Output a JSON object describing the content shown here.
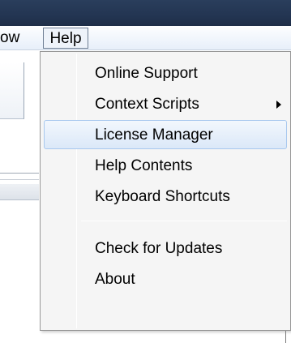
{
  "menubar": {
    "items": [
      {
        "label": "Window",
        "visible_label": "ow"
      },
      {
        "label": "Help"
      }
    ]
  },
  "help_menu": {
    "items": [
      {
        "label": "Online Support"
      },
      {
        "label": "Context Scripts",
        "has_submenu": true
      },
      {
        "label": "License Manager",
        "highlighted": true
      },
      {
        "label": "Help Contents"
      },
      {
        "label": "Keyboard Shortcuts"
      },
      {
        "label": "Check for Updates"
      },
      {
        "label": "About"
      }
    ]
  },
  "colors": {
    "titlebar": "#233552",
    "highlight_border": "#a8c8ee",
    "highlight_fill": "#dbe8f8",
    "menu_bg": "#f5f5f5"
  }
}
